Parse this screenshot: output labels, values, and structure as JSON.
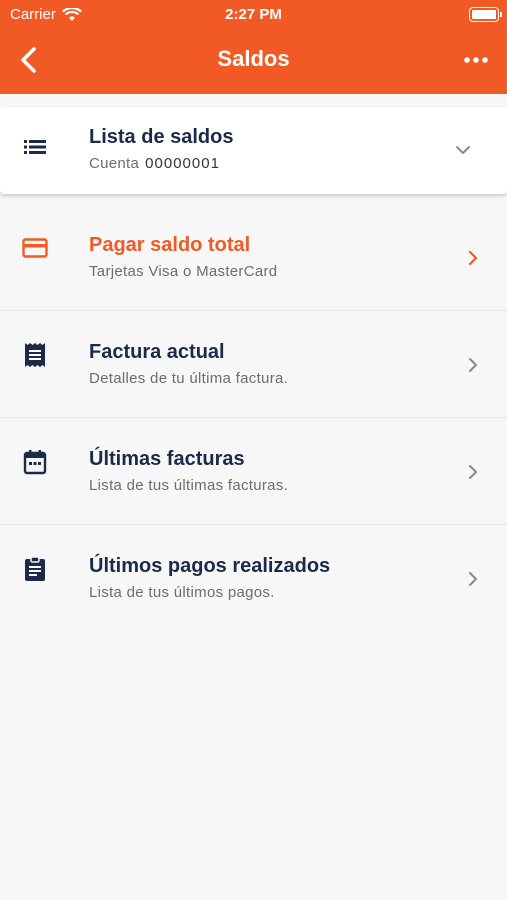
{
  "status_bar": {
    "carrier": "Carrier",
    "time": "2:27 PM"
  },
  "header": {
    "title": "Saldos",
    "back_icon": "chevron-left-icon",
    "more_icon": "more-horizontal-icon"
  },
  "account_selector": {
    "title": "Lista de saldos",
    "account_label": "Cuenta",
    "account_value": "00000001",
    "icon": "list-icon"
  },
  "menu": [
    {
      "title": "Pagar saldo total",
      "subtitle": "Tarjetas Visa o MasterCard",
      "icon": "credit-card-icon",
      "accent": true
    },
    {
      "title": "Factura actual",
      "subtitle": "Detalles de tu última factura.",
      "icon": "receipt-icon",
      "accent": false
    },
    {
      "title": "Últimas facturas",
      "subtitle": "Lista de tus últimas facturas.",
      "icon": "calendar-icon",
      "accent": false
    },
    {
      "title": "Últimos pagos realizados",
      "subtitle": "Lista de tus últimos pagos.",
      "icon": "clipboard-icon",
      "accent": false
    }
  ],
  "colors": {
    "brand": "#f15a24",
    "navy": "#1b2a4a",
    "background": "#f7f7f7"
  }
}
